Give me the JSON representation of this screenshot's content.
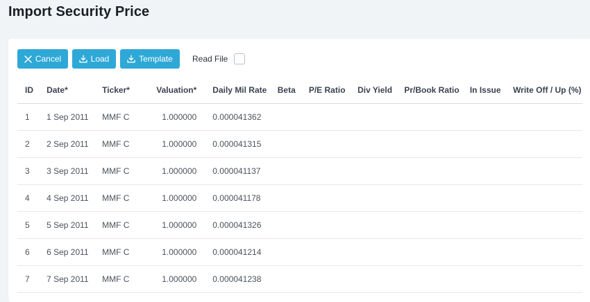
{
  "page": {
    "title": "Import Security Price"
  },
  "toolbar": {
    "cancel_label": "Cancel",
    "cancel_icon": "close-icon",
    "load_label": "Load",
    "load_icon": "download-icon",
    "template_label": "Template",
    "template_icon": "download-icon",
    "read_file_label": "Read File",
    "read_file_checked": false,
    "accent_color": "#2ea8d6"
  },
  "table": {
    "columns": {
      "id": "ID",
      "date": "Date*",
      "ticker": "Ticker*",
      "valuation": "Valuation*",
      "daily_mil_rate": "Daily Mil Rate",
      "beta": "Beta",
      "pe_ratio": "P/E Ratio",
      "div_yield": "Div Yield",
      "pr_book_ratio": "Pr/Book Ratio",
      "in_issue": "In Issue",
      "write_off_up": "Write Off / Up (%)"
    },
    "rows": [
      {
        "id": "1",
        "date": "1 Sep 2011",
        "ticker": "MMF C",
        "valuation": "1.000000",
        "daily_mil_rate": "0.000041362",
        "beta": "",
        "pe_ratio": "",
        "div_yield": "",
        "pr_book_ratio": "",
        "in_issue": "",
        "write_off_up": ""
      },
      {
        "id": "2",
        "date": "2 Sep 2011",
        "ticker": "MMF C",
        "valuation": "1.000000",
        "daily_mil_rate": "0.000041315",
        "beta": "",
        "pe_ratio": "",
        "div_yield": "",
        "pr_book_ratio": "",
        "in_issue": "",
        "write_off_up": ""
      },
      {
        "id": "3",
        "date": "3 Sep 2011",
        "ticker": "MMF C",
        "valuation": "1.000000",
        "daily_mil_rate": "0.000041137",
        "beta": "",
        "pe_ratio": "",
        "div_yield": "",
        "pr_book_ratio": "",
        "in_issue": "",
        "write_off_up": ""
      },
      {
        "id": "4",
        "date": "4 Sep 2011",
        "ticker": "MMF C",
        "valuation": "1.000000",
        "daily_mil_rate": "0.000041178",
        "beta": "",
        "pe_ratio": "",
        "div_yield": "",
        "pr_book_ratio": "",
        "in_issue": "",
        "write_off_up": ""
      },
      {
        "id": "5",
        "date": "5 Sep 2011",
        "ticker": "MMF C",
        "valuation": "1.000000",
        "daily_mil_rate": "0.000041326",
        "beta": "",
        "pe_ratio": "",
        "div_yield": "",
        "pr_book_ratio": "",
        "in_issue": "",
        "write_off_up": ""
      },
      {
        "id": "6",
        "date": "6 Sep 2011",
        "ticker": "MMF C",
        "valuation": "1.000000",
        "daily_mil_rate": "0.000041214",
        "beta": "",
        "pe_ratio": "",
        "div_yield": "",
        "pr_book_ratio": "",
        "in_issue": "",
        "write_off_up": ""
      },
      {
        "id": "7",
        "date": "7 Sep 2011",
        "ticker": "MMF C",
        "valuation": "1.000000",
        "daily_mil_rate": "0.000041238",
        "beta": "",
        "pe_ratio": "",
        "div_yield": "",
        "pr_book_ratio": "",
        "in_issue": "",
        "write_off_up": ""
      }
    ]
  }
}
